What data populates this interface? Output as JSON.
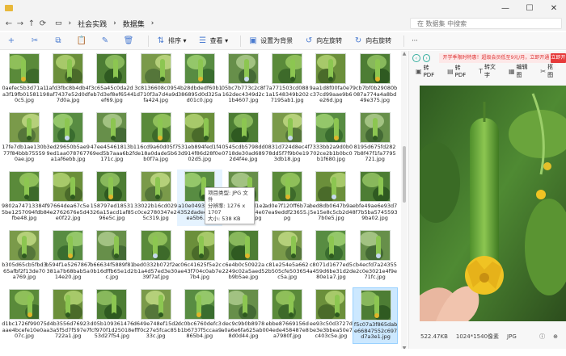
{
  "window": {
    "path": [
      "社会实践",
      "数据集"
    ],
    "controls": [
      "—",
      "☐",
      "✕"
    ]
  },
  "search": {
    "placeholder": "在 数据集 中搜索"
  },
  "toolbar": {
    "items": [
      {
        "name": "new-button",
        "label": "",
        "icon": "+"
      },
      {
        "name": "cut-button",
        "label": "",
        "icon": "✂"
      },
      {
        "name": "copy-button",
        "label": "",
        "icon": "⧉"
      },
      {
        "name": "paste-button",
        "label": "",
        "icon": "📋"
      },
      {
        "name": "rename-button",
        "label": "",
        "icon": "✎"
      },
      {
        "name": "delete-button",
        "label": "",
        "icon": "🗑"
      },
      {
        "name": "sort-button",
        "label": "排序 ▾",
        "icon": "⇅"
      },
      {
        "name": "view-button",
        "label": "查看 ▾",
        "icon": "☰"
      },
      {
        "name": "set-background-button",
        "label": "设置为背景",
        "icon": "▣"
      },
      {
        "name": "rotate-left-button",
        "label": "向左旋转",
        "icon": "↺"
      },
      {
        "name": "rotate-right-button",
        "label": "向右旋转",
        "icon": "↻"
      },
      {
        "name": "more-button",
        "label": "···",
        "icon": ""
      }
    ]
  },
  "files": [
    {
      "name": "0aefec5b3d71a1a3f19fb01581190c5.jpg"
    },
    {
      "name": "1afd3fbc8b4db4f8af7437e52d0df7d0a.jpg"
    },
    {
      "name": "3c65a45c0da2deb7d3ef8ef6544ef69.jpg"
    },
    {
      "name": "3c8136608c0951d710f3a7d4a9dfa424.jpg"
    },
    {
      "name": "4b28dbdedf60b1386895d0d325ad01c0.jpg"
    },
    {
      "name": "05bc7b773c2c8f162dec4349d2c1b4607.jpg"
    },
    {
      "name": "7a771503cd0881a1548349b2027195ab1.jpg"
    },
    {
      "name": "9aa1d8f00fa0e7c37cd99aae9b6e26d.jpg"
    },
    {
      "name": "9cb7bf0b29080b087a774a4a8bd49e375.jpg"
    },
    {
      "name": "17fe7db1ae130b77f84bbb755590ae.jpg"
    },
    {
      "name": "3ed29650b5ae99ed1aa0787677a1af6ebb.jpg"
    },
    {
      "name": "47ee45461813b69ed5b7aaa6b2f171c.jpg"
    },
    {
      "name": "116cd9a60d05f7de18a0dade5b6b0f7a.jpg"
    },
    {
      "name": "531eb894fed1f43d914f86d28f0e02d5.jpg"
    },
    {
      "name": "0545cdb5798dd0718de30ad6892d4f4e.jpg"
    },
    {
      "name": "0831d724d8ec4f78dd5f7f9b0e193db18.jpg"
    },
    {
      "name": "7333bb2a9d0b0702ce2b1b0bc0b1f680.jpg"
    },
    {
      "name": "8195d675fd2827b8f47f1fa7795721.jpg"
    },
    {
      "name": "9802a74713384f5be1257094fdb8fbe48.jpg"
    },
    {
      "name": "97664dea67c5e4e2762676e5d4e0f22.jpg"
    },
    {
      "name": "158797ed18531326a15acd1af8596e5c.jpg"
    },
    {
      "name": "33022b16cd029c0ce2780347e25c319.jpg"
    },
    {
      "name": "a10e0493ebd5a4352dadee46fe0ea5b6.jpg"
    },
    {
      "name": "ac0026042fd1e285a5198b1d4e01486752a.jpg"
    },
    {
      "name": "ad0e7f120ff6b7a7ea9eddf23655.jpg"
    },
    {
      "name": "bed8db0647b9a5e15e8c5cb2d47b0e5.jpg"
    },
    {
      "name": "ebfe49ae6e93d78f7b5ba57455939ba02.jpg"
    },
    {
      "name": "b305d65cb5fbd365afbf2f13de70a769.jpg"
    },
    {
      "name": "b594f1e5267867381a7b68bab5a14e20.jpg"
    },
    {
      "name": "b66634f5889f810b16dffb65e1d2c.jpg"
    },
    {
      "name": "bed0332b072f2eb1a4d57ed3e3039f7af.jpg"
    },
    {
      "name": "c06c41625f5e2cae43f704c0ab7e7b4.jpg"
    },
    {
      "name": "c6e4b0c50922a2249c02a5aed5b9b5ae.jpg"
    },
    {
      "name": "c81e254e5a6622b505cfe503654c5a.jpg"
    },
    {
      "name": "c8071d1677ed5a459d6be31d2d80e1a7.jpg"
    },
    {
      "name": "cb4ecfd7a24355e2c0e3021e4f9e71fc.jpg"
    },
    {
      "name": "d1bc1726f99075aae4bcefe10e0a07c.jpg"
    },
    {
      "name": "d4b3556d76923a3a5f5d7f597e7722a1.jpg"
    },
    {
      "name": "d05b109361476fcf970f1d25018e53d27f54.jpg"
    },
    {
      "name": "d649e748ef15d2fff0c27e5fcac8533c.jpg"
    },
    {
      "name": "dc0bc6760defc3b1b6737f5ccaa9865b4.jpg"
    },
    {
      "name": "dec9c9b0b8978a0a6e6fa625ab08d0d44.jpg"
    },
    {
      "name": "ebbe87669156d04ede458487e8a7980f.jpg"
    },
    {
      "name": "ee93c50d3727dbe3e3bbea50e7c403c5e.jpg"
    },
    {
      "name": "f5c07a3f865dabe66847552c697d7a3e1.jpg"
    }
  ],
  "tooltip": {
    "line1": "项目类型: JPG 文件",
    "line2": "分辨率: 1276 x 1707",
    "line3": "大小: 538 KB"
  },
  "preview": {
    "ad_text": "开学季限时特惠！超级会员低至9元/月，立即开通",
    "ad_button": "立即开通",
    "tools": [
      {
        "icon": "▣",
        "label": "转PDF"
      },
      {
        "icon": "▤",
        "label": "转PDF"
      },
      {
        "icon": "T",
        "label": "转文字"
      },
      {
        "icon": "▦",
        "label": "编辑图"
      },
      {
        "icon": "✂",
        "label": "抠图"
      }
    ],
    "size": "522.47KB",
    "dims": "1024*1540像素",
    "format": "JPG"
  },
  "statusbar": {
    "text": ""
  }
}
